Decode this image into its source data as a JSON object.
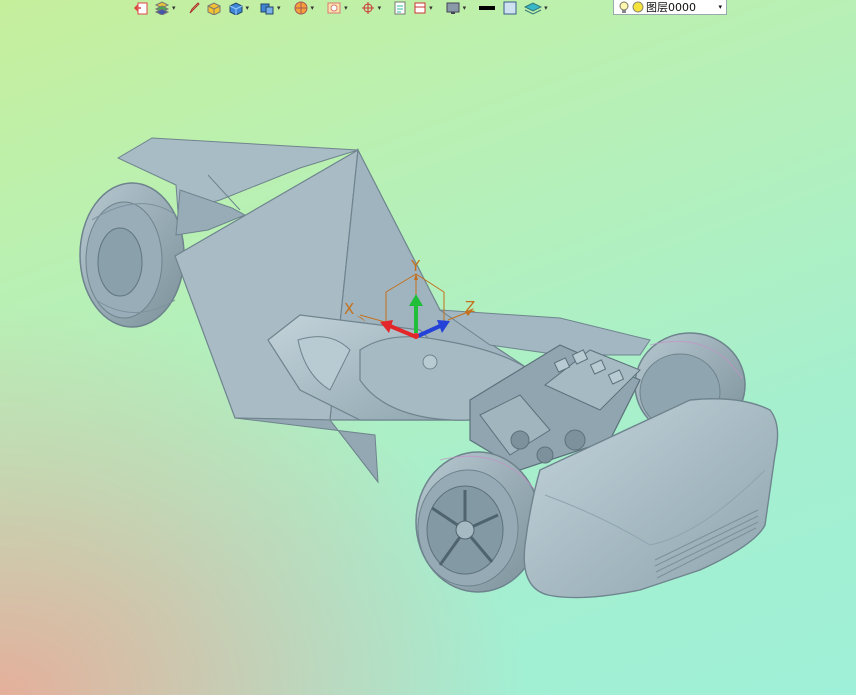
{
  "toolbar": {
    "buttons": [
      {
        "icon": "open-file-icon",
        "has_dropdown": false
      },
      {
        "icon": "layers-stack-icon",
        "has_dropdown": true
      },
      {
        "icon": "pen-icon",
        "has_dropdown": false
      },
      {
        "icon": "solid-box-icon",
        "has_dropdown": false
      },
      {
        "icon": "blue-cube-icon",
        "has_dropdown": true
      },
      {
        "icon": "cube-multi-icon",
        "has_dropdown": true
      },
      {
        "icon": "sphere-render-icon",
        "has_dropdown": true
      },
      {
        "icon": "view-frame-icon",
        "has_dropdown": true
      },
      {
        "icon": "crosshair-icon",
        "has_dropdown": true
      },
      {
        "icon": "document-icon",
        "has_dropdown": false
      },
      {
        "icon": "ruler-frame-icon",
        "has_dropdown": true
      },
      {
        "icon": "monitor-icon",
        "has_dropdown": true
      },
      {
        "icon": "line-color-icon",
        "has_dropdown": false
      },
      {
        "icon": "fill-color-icon",
        "has_dropdown": false
      },
      {
        "icon": "layer-stack-icon",
        "has_dropdown": true
      }
    ],
    "layer_select": {
      "value": "图层0000",
      "icons": [
        "lightbulb-icon",
        "yellow-dot-icon"
      ]
    }
  },
  "triad": {
    "x_label": "X",
    "y_label": "Y",
    "z_label": "Z"
  },
  "colors": {
    "model_fill": "#a3b8c2",
    "model_dark": "#7d929c",
    "model_light": "#c6d5dc",
    "axis_x": "#e3262a",
    "axis_y": "#1fbf3a",
    "axis_z": "#2441d8",
    "axis_label": "#c4701c"
  }
}
